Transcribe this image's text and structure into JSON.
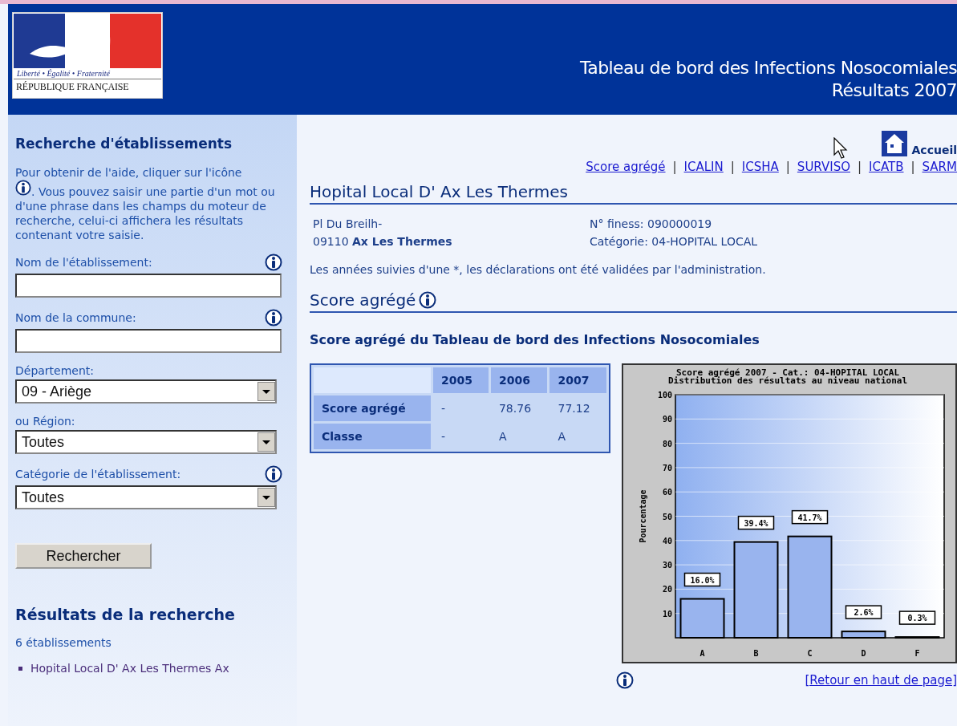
{
  "header": {
    "logo": {
      "motto": "Liberté • Égalité • Fraternité",
      "name": "RÉPUBLIQUE FRANÇAISE"
    },
    "title": "Tableau de bord des Infections Nosocomiales",
    "subtitle": "Résultats 2007"
  },
  "sidebar": {
    "title": "Recherche d'établissements",
    "help_before": "Pour obtenir de l'aide, cliquer sur l'icône",
    "help_after": ". Vous pouvez saisir une partie d'un mot ou d'une phrase dans les champs du moteur de recherche, celui-ci affichera les résultats contenant votre saisie.",
    "fields": [
      {
        "kind": "text",
        "label": "Nom de l'établissement:",
        "info": true
      },
      {
        "kind": "text",
        "label": "Nom de la commune:",
        "info": true
      },
      {
        "kind": "select",
        "label": "Département:",
        "value": "09 - Ariège",
        "info": false
      },
      {
        "kind": "select",
        "label": "ou Région:",
        "value": "Toutes",
        "info": false
      },
      {
        "kind": "select",
        "label": "Catégorie de l'établissement:",
        "value": "Toutes",
        "info": true
      }
    ],
    "button": "Rechercher",
    "results_title": "Résultats de la recherche",
    "results_count": "6 établissements",
    "results": [
      "Hopital Local D' Ax Les Thermes Ax"
    ]
  },
  "main": {
    "home_link": "Accueil",
    "nav": [
      "Score agrégé",
      "ICALIN",
      "ICSHA",
      "SURVISO",
      "ICATB",
      "SARM"
    ],
    "separator": "|",
    "hospital": {
      "name": "Hopital Local D' Ax Les Thermes",
      "street": "Pl Du Breilh-",
      "postcode": "09110",
      "city": "Ax Les Thermes",
      "finess": "N° finess: 090000019",
      "category": "Catégorie: 04-HOPITAL LOCAL"
    },
    "note": "Les années suivies d'une *, les déclarations ont été validées par l'administration.",
    "section_title": "Score agrégé",
    "subtitle": "Score agrégé du Tableau de bord des Infections Nosocomiales",
    "table": {
      "columns": [
        "2005",
        "2006",
        "2007"
      ],
      "rows": [
        {
          "label": "Score agrégé",
          "cells": [
            "-",
            "78.76",
            "77.12"
          ]
        },
        {
          "label": "Classe",
          "cells": [
            "-",
            "A",
            "A"
          ]
        }
      ]
    },
    "chart": {
      "subtitle": "Distribution des résultats au niveau national",
      "chart_data": {
        "type": "bar",
        "title": "Score agrégé 2007 - Cat.: 04-HOPITAL LOCAL",
        "ylabel": "Pourcentage",
        "categories": [
          "A",
          "B",
          "C",
          "D",
          "F"
        ],
        "grid": true,
        "series": [
          {
            "color": "#99b4ee",
            "values": [
              16.0,
              39.4,
              41.7,
              2.6,
              0.3
            ]
          }
        ],
        "ylim": [
          0,
          100
        ],
        "yticks": [
          10,
          20,
          30,
          40,
          50,
          60,
          70,
          80,
          90,
          100
        ],
        "value_labels": [
          "16.0%",
          "39.4%",
          "41.7%",
          "2.6%",
          "0.3%"
        ]
      }
    },
    "back_link": "[Retour en haut de page]"
  }
}
